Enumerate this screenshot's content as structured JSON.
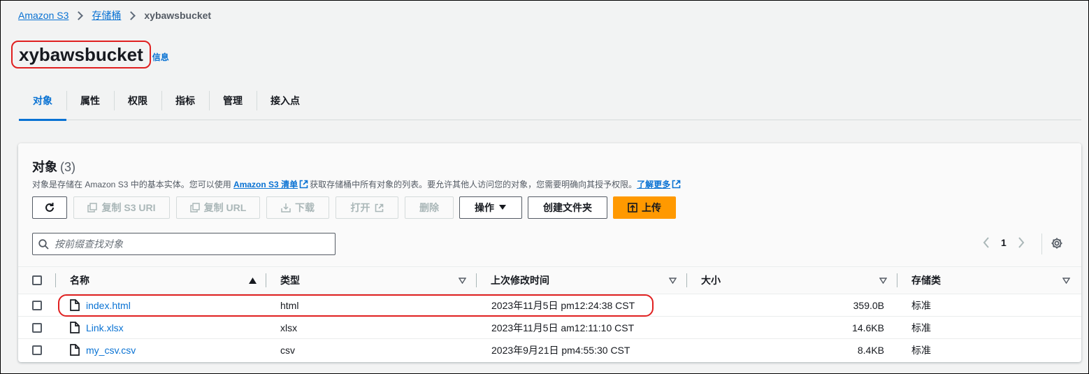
{
  "breadcrumb": {
    "root": "Amazon S3",
    "buckets": "存储桶",
    "current": "xybawsbucket"
  },
  "page": {
    "title": "xybawsbucket",
    "info_link": "信息"
  },
  "tabs": [
    {
      "label": "对象",
      "active": true
    },
    {
      "label": "属性",
      "active": false
    },
    {
      "label": "权限",
      "active": false
    },
    {
      "label": "指标",
      "active": false
    },
    {
      "label": "管理",
      "active": false
    },
    {
      "label": "接入点",
      "active": false
    }
  ],
  "objects_panel": {
    "title": "对象",
    "count": "(3)",
    "desc_prefix": "对象是存储在 Amazon S3 中的基本实体。您可以使用 ",
    "desc_link": "Amazon S3 清单",
    "desc_middle": "获取存储桶中所有对象的列表。要允许其他人访问您的对象，您需要明确向其授予权限。",
    "learn_more": "了解更多"
  },
  "toolbar": {
    "refresh_icon": "refresh-icon",
    "copy_s3_uri": "复制 S3 URI",
    "copy_url": "复制 URL",
    "download": "下载",
    "open": "打开",
    "delete": "删除",
    "actions": "操作",
    "create_folder": "创建文件夹",
    "upload": "上传"
  },
  "search": {
    "placeholder": "按前缀查找对象",
    "value": ""
  },
  "pagination": {
    "current_page": "1"
  },
  "table": {
    "columns": [
      "名称",
      "类型",
      "上次修改时间",
      "大小",
      "存储类"
    ],
    "rows": [
      {
        "name": "index.html",
        "type": "html",
        "modified": "2023年11月5日 pm12:24:38 CST",
        "size": "359.0B",
        "storage_class": "标准"
      },
      {
        "name": "Link.xlsx",
        "type": "xlsx",
        "modified": "2023年11月5日 am12:11:10 CST",
        "size": "14.6KB",
        "storage_class": "标准"
      },
      {
        "name": "my_csv.csv",
        "type": "csv",
        "modified": "2023年9月21日 pm4:55:30 CST",
        "size": "8.4KB",
        "storage_class": "标准"
      }
    ]
  },
  "colors": {
    "link": "#0972d3",
    "primary_button": "#ff9900",
    "highlight": "#e02020"
  }
}
